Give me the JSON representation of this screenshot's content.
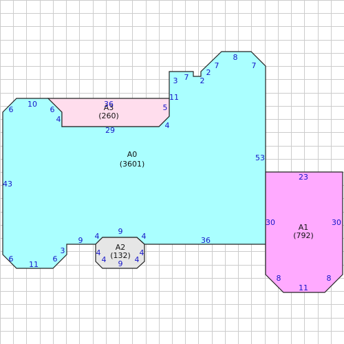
{
  "colors": {
    "grid": "#cccccc",
    "outline": "#222222",
    "edge_label": "#1515c8",
    "region_fills": {
      "A0": "#aaffff",
      "A1": "#ffaaff",
      "A2": "#e6e6e6",
      "A3": "#ffdded"
    }
  },
  "regions": {
    "A0": {
      "name": "A0",
      "area": "(3601)"
    },
    "A1": {
      "name": "A1",
      "area": "(792)"
    },
    "A2": {
      "name": "A2",
      "area": "(132)"
    },
    "A3": {
      "name": "A3",
      "area": "(260)"
    }
  },
  "edge_labels": {
    "a0_upper_left_diag": "6",
    "a0_top_left": "10",
    "a0_notch_diag": "6",
    "a0_notch_drop": "4",
    "a0_notch_floor": "29",
    "a0_right_step_diag": "4",
    "a0_step_rise": "11",
    "a0_small_top_a": "3",
    "a0_small_top_b": "7",
    "a0_tab_drop": "2",
    "a0_tab_rise": "2",
    "a0_top_diag": "7",
    "a0_top_right": "8",
    "a0_right_diag": "7",
    "a0_right_side": "53",
    "a0_bottom_right": "36",
    "a0_left_side": "43",
    "a0_lower_left_diag": "6",
    "a0_bottom_left": "11",
    "a0_lower_right_diag": "6",
    "a0_small_rise": "3",
    "a0_shelf": "9",
    "a3_top": "36",
    "a3_right": "5",
    "a2_top": "9",
    "a2_top_left": "4",
    "a2_top_right": "4",
    "a2_left": "4",
    "a2_right": "4",
    "a2_bottom_left": "4",
    "a2_bottom_right": "4",
    "a2_bottom": "9",
    "a1_top": "23",
    "a1_left": "30",
    "a1_right": "30",
    "a1_bottom_left": "8",
    "a1_bottom": "11",
    "a1_bottom_right": "8"
  }
}
